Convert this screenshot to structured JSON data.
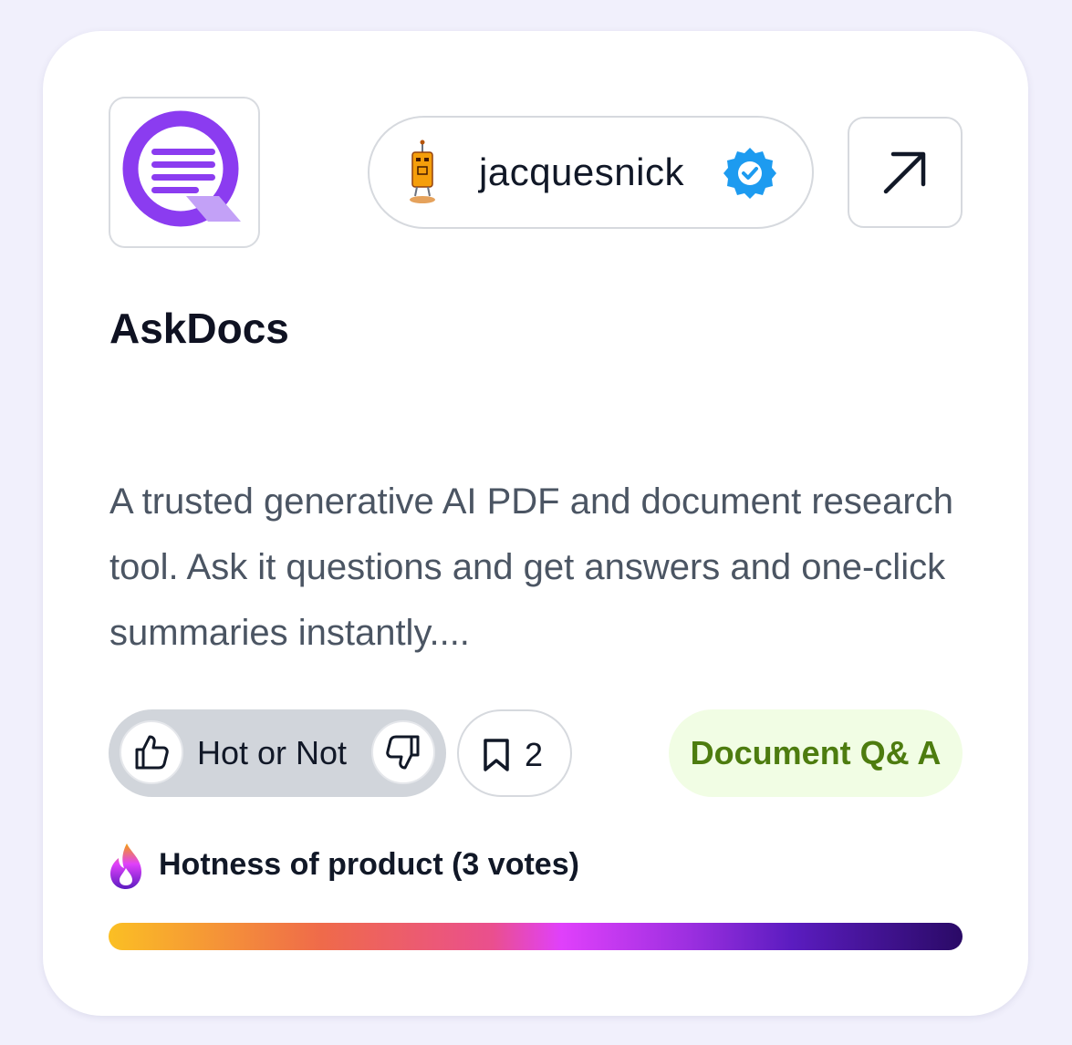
{
  "product": {
    "name": "AskDocs",
    "logo_icon": "askdocs-q-logo-icon",
    "description": "A trusted generative AI PDF and document research tool. Ask it questions and get answers and one-click summaries instantly...."
  },
  "author": {
    "username": "jacquesnick",
    "verified": true,
    "avatar_icon": "robot-avatar-icon",
    "verified_icon": "verified-badge-icon"
  },
  "actions": {
    "open_icon": "arrow-up-right-icon",
    "vote_label": "Hot or Not",
    "upvote_icon": "thumbs-up-icon",
    "downvote_icon": "thumbs-down-icon",
    "bookmark_icon": "bookmark-icon",
    "bookmark_count": "2"
  },
  "tag": {
    "label": "Document Q& A",
    "bg_color": "#f1fde4",
    "text_color": "#4d7c0f"
  },
  "hotness": {
    "label": "Hotness of product (3 votes)",
    "icon": "flame-icon",
    "level": 1.0
  },
  "colors": {
    "brand_purple": "#8b3cf0",
    "verified_blue": "#1d9bf0",
    "page_background": "#f1f0fc"
  }
}
